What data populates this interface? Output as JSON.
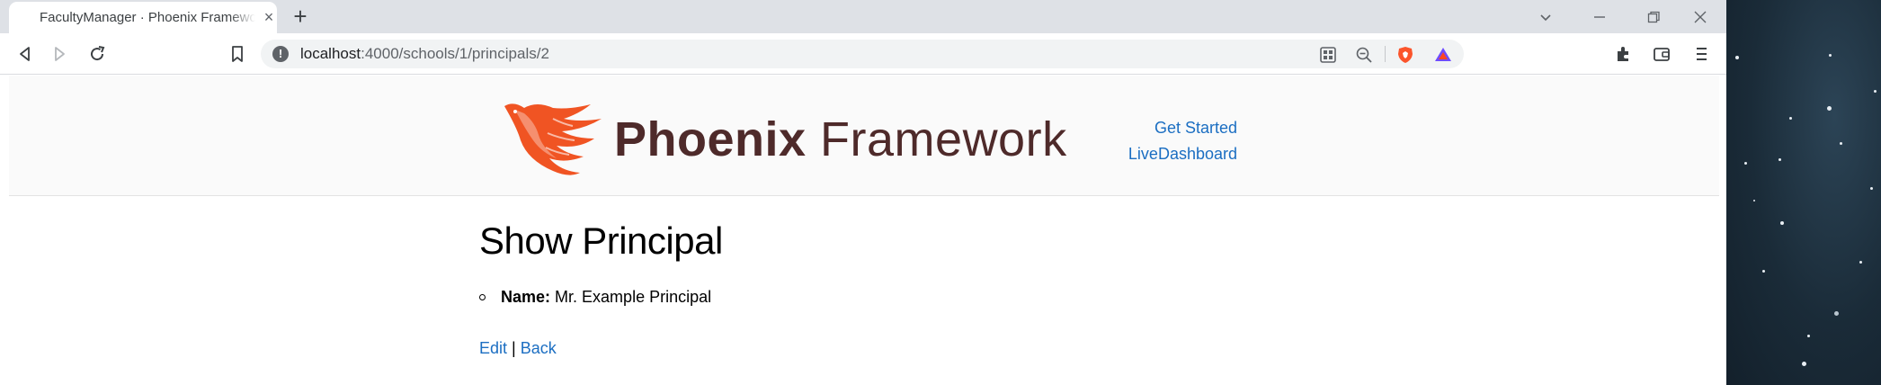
{
  "browser": {
    "tab_title": "FacultyManager · Phoenix Framework",
    "new_tab_label": "+",
    "tab_close_label": "×",
    "url_host": "localhost",
    "url_path": ":4000/schools/1/principals/2"
  },
  "header": {
    "logo_bold": "Phoenix",
    "logo_light": " Framework",
    "nav": {
      "get_started": "Get Started",
      "live_dashboard": "LiveDashboard"
    }
  },
  "main": {
    "title": "Show Principal",
    "details": [
      {
        "label": "Name:",
        "value": "Mr. Example Principal"
      }
    ],
    "actions": {
      "edit": "Edit",
      "separator": "|",
      "back": "Back"
    }
  },
  "colors": {
    "link": "#1b6ec2",
    "logo_text": "#4e2a2a",
    "phoenix_orange": "#f05423"
  }
}
